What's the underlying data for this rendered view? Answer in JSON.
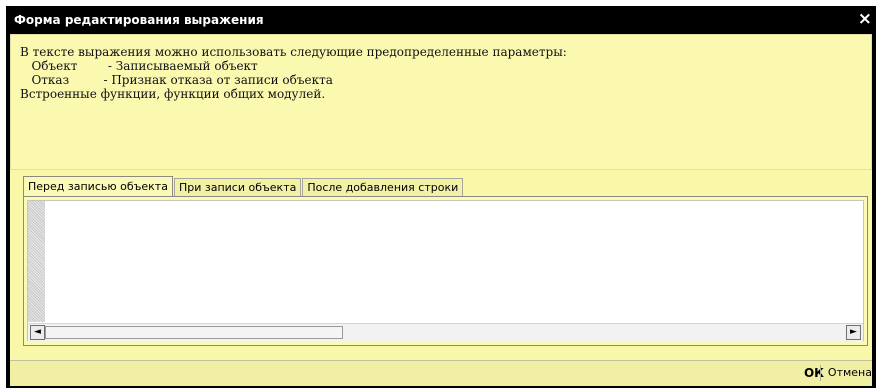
{
  "window": {
    "title": "Форма редактирования выражения",
    "close_glyph": "×"
  },
  "hint": {
    "lines": [
      "В тексте выражения можно использовать следующие предопределенные параметры:",
      "   Объект        - Записываемый объект",
      "   Отказ         - Признак отказа от записи объекта",
      "Встроенные функции, функции общих модулей."
    ]
  },
  "tabs": [
    {
      "label": "Перед записью объекта",
      "active": true
    },
    {
      "label": "При записи объекта",
      "active": false
    },
    {
      "label": "После добавления строки",
      "active": false
    }
  ],
  "editor": {
    "text": ""
  },
  "scrollbar": {
    "left_glyph": "◄",
    "right_glyph": "►"
  },
  "footer": {
    "ok_label": "ОК",
    "cancel_label": "Отмена"
  },
  "colors": {
    "titlebar": "#000000",
    "background": "#f9f7a8",
    "hint_background": "#fbf9b0"
  }
}
